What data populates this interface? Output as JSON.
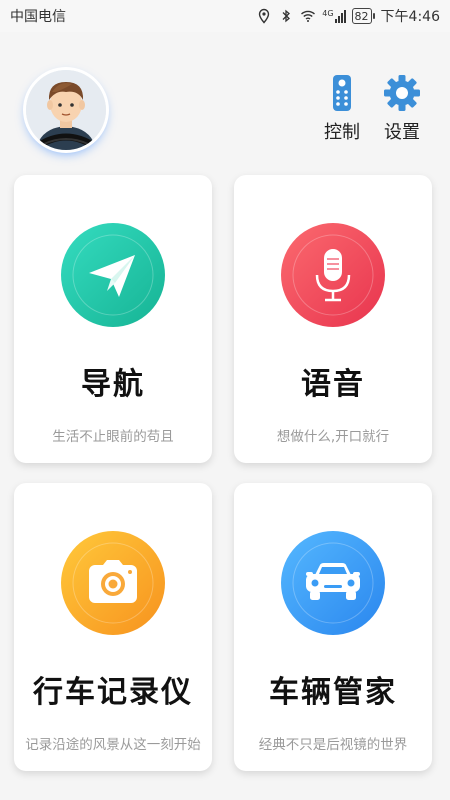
{
  "status_bar": {
    "carrier": "中国电信",
    "network": "4G",
    "battery": "82",
    "time": "下午4:46"
  },
  "header": {
    "avatar_icon": "driver-avatar-icon",
    "actions": [
      {
        "label": "控制",
        "icon": "remote-control-icon"
      },
      {
        "label": "设置",
        "icon": "gear-icon"
      }
    ]
  },
  "cards": [
    {
      "title": "导航",
      "subtitle": "生活不止眼前的苟且",
      "icon": "paper-plane-icon",
      "color": "#1fc9a8"
    },
    {
      "title": "语音",
      "subtitle": "想做什么,开口就行",
      "icon": "microphone-icon",
      "color": "#f0485f"
    },
    {
      "title": "行车记录仪",
      "subtitle": "记录沿途的风景从这一刻开始",
      "icon": "camera-icon",
      "color": "#fba924"
    },
    {
      "title": "车辆管家",
      "subtitle": "经典不只是后视镜的世界",
      "icon": "car-icon",
      "color": "#3a9cf5"
    }
  ],
  "colors": {
    "accent_blue": "#2f8bff",
    "icon_blue": "#3c8fd8",
    "background": "#f5f5f5"
  }
}
